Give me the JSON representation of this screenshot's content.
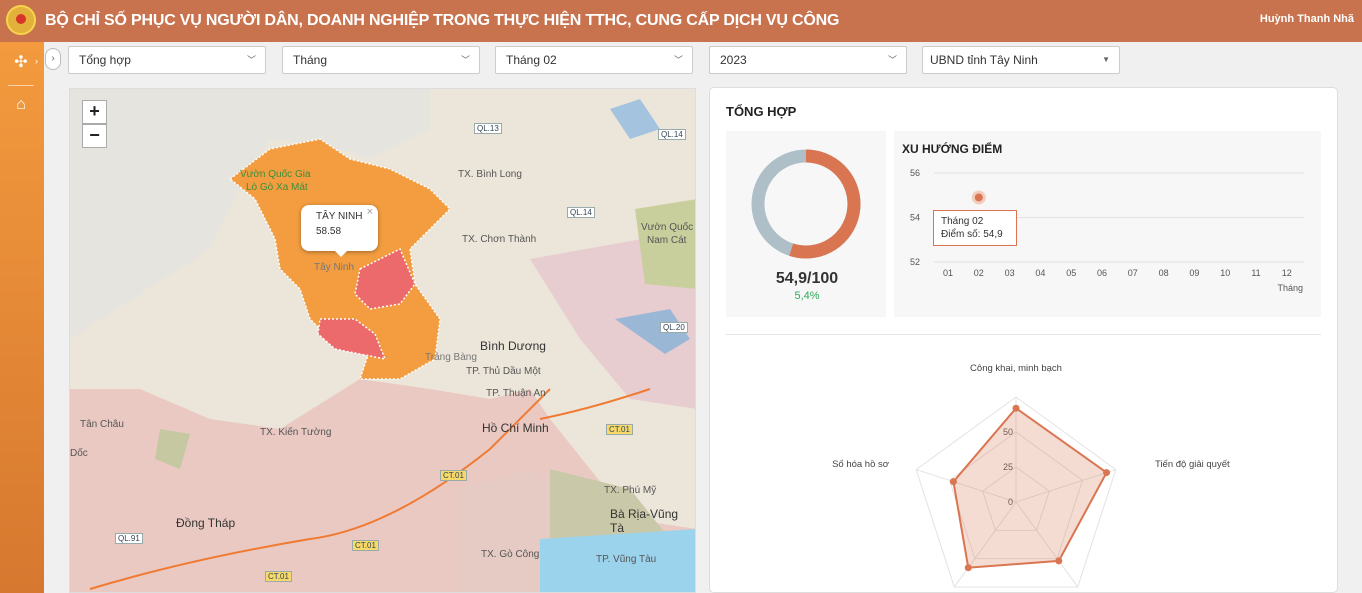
{
  "header": {
    "title": "BỘ CHỈ SỐ PHỤC VỤ NGƯỜI DÂN, DOANH NGHIỆP TRONG THỰC HIỆN TTHC, CUNG CẤP DỊCH VỤ CÔNG",
    "user": "Huỳnh Thanh Nhã"
  },
  "filters": {
    "category": "Tổng hợp",
    "period_type": "Tháng",
    "period": "Tháng 02",
    "year": "2023",
    "unit": "UBND tỉnh Tây Ninh"
  },
  "map": {
    "zoom_in": "+",
    "zoom_out": "−",
    "popup": {
      "province": "TÂY NINH",
      "value": "58.58"
    },
    "labels": {
      "park1": "Vườn Quốc Gia",
      "park2": "Lò Gò Xa Mát",
      "binh_long": "TX. Bình Long",
      "chon_thanh": "TX. Chơn Thành",
      "vuon_quoc": "Vườn Quốc",
      "nam_cat": "Nam Cát",
      "tay_ninh": "Tây Ninh",
      "binh_duong": "Bình Dương",
      "thu_dau_mot": "TP. Thủ Dầu Một",
      "thuan_an": "TP. Thuận An",
      "ho_chi_minh": "Hồ Chí Minh",
      "kien_tuong": "TX. Kiến Tường",
      "tan_chau": "Tân Châu",
      "doc": "Dốc",
      "dong_thap": "Đồng Tháp",
      "phu_my": "TX. Phú Mỹ",
      "brvt": "Bà Rịa-Vũng Tà",
      "go_cong": "TX. Gò Công",
      "vung_tau": "TP. Vũng Tàu",
      "trang_bang": "Trảng Bàng"
    },
    "roads": {
      "ql13": "QL.13",
      "ql14a": "QL.14",
      "ql14b": "QL.14",
      "ql20": "QL.20",
      "ct01a": "CT.01",
      "ct01b": "CT.01",
      "ct01c": "CT.01",
      "ct01d": "CT.01",
      "ql91": "QL.91"
    }
  },
  "summary": {
    "title": "TỔNG HỢP",
    "score_label": "54,9/100",
    "score_change": "5,4%",
    "score_value": 54.9,
    "score_max": 100,
    "colors": {
      "score": "#d97551",
      "rest": "#aebfc8"
    }
  },
  "trend": {
    "title": "XU HƯỚNG ĐIỂM",
    "x_axis_label": "Tháng",
    "tooltip": {
      "line1": "Tháng 02",
      "line2": "Điểm số: 54,9"
    }
  },
  "radar": {
    "axes": {
      "top": "Công khai, minh bạch",
      "right": "Tiến độ giải quyết",
      "left": "Số hóa hồ sơ"
    }
  },
  "chart_data": [
    {
      "type": "line",
      "title": "XU HƯỚNG ĐIỂM",
      "xlabel": "Tháng",
      "categories": [
        "01",
        "02",
        "03",
        "04",
        "05",
        "06",
        "07",
        "08",
        "09",
        "10",
        "11",
        "12"
      ],
      "yticks": [
        52,
        54,
        56
      ],
      "ylim": [
        52,
        56
      ],
      "series": [
        {
          "values": [
            null,
            54.9,
            null,
            null,
            null,
            null,
            null,
            null,
            null,
            null,
            null,
            null
          ]
        }
      ]
    },
    {
      "type": "radar",
      "axes": [
        "Công khai, minh bạch",
        "Tiến độ giải quyết",
        "",
        "",
        "Số hóa hồ sơ"
      ],
      "ticks": [
        0,
        25,
        50
      ],
      "rmax": 75,
      "series": [
        {
          "values": [
            67,
            68,
            52,
            58,
            47
          ]
        }
      ],
      "color": "#d97551"
    }
  ]
}
